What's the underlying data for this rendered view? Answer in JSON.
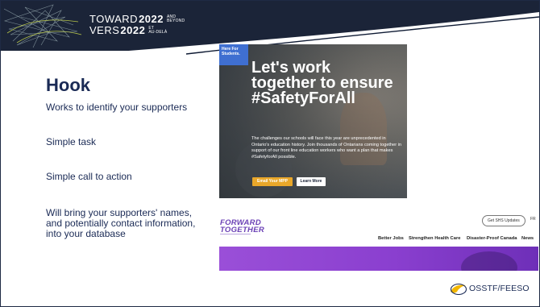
{
  "header": {
    "line1_prefix": "TOWARD",
    "line1_year": "2022",
    "line1_suffix_a": "AND",
    "line1_suffix_b": "BEYOND",
    "line2_prefix": "VERS",
    "line2_year": "2022",
    "line2_suffix_a": "ET",
    "line2_suffix_b": "AU-DELÀ"
  },
  "slide": {
    "title": "Hook",
    "bullets": [
      "Works to identify your supporters",
      "Simple task",
      "Simple call to action",
      "Will bring your supporters' names, and potentially contact information, into your database"
    ]
  },
  "banner": {
    "badge": "Here For Students.",
    "headline": "Let's work together to ensure #SafetyForAll",
    "body": "The challenges our schools will face this year are unprecedented in Ontario's education history. Join thousands of Ontarians coming together in support of our front line education workers who want a plan that makes #SafetyforAll possible.",
    "email_button": "Email Your MPP",
    "learn_button": "Learn More"
  },
  "website": {
    "brand_line1": "FORWARD",
    "brand_line2": "TOGETHER",
    "updates_button": "Get SHS Updates",
    "lang_link": "FR",
    "nav": [
      "Better Jobs",
      "Strengthen Health Care",
      "Disaster-Proof Canada",
      "News"
    ]
  },
  "footer": {
    "logo_text": "OSSTF/FEESO"
  },
  "colors": {
    "navy": "#1b2438",
    "title_text": "#1a2a55",
    "badge_blue": "#3f6fd1",
    "email_orange": "#e9a72a",
    "site_purple": "#8a3fcf",
    "logo_yellow": "#f2b600"
  }
}
